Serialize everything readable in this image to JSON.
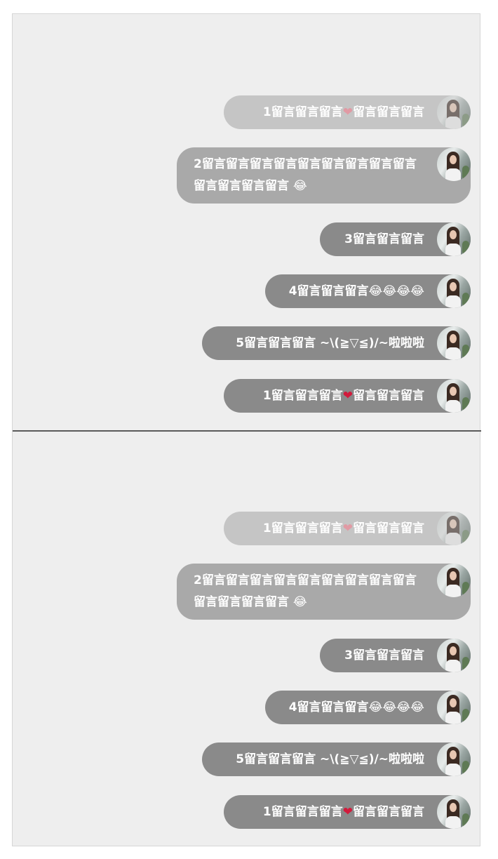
{
  "panels": [
    {
      "messages": [
        {
          "text": "1留言留言留言",
          "heart": "❤",
          "text_after": "留言留言留言"
        },
        {
          "text": "2留言留言留言留言留言留言留言留言留言留言留言留言留言 😂"
        },
        {
          "text": "3留言留言留言"
        },
        {
          "text": "4留言留言留言😂😂😂😂"
        },
        {
          "text": "5留言留言留言 ~\\(≧▽≦)/~啦啦啦"
        },
        {
          "text": "1留言留言留言",
          "heart": "❤",
          "text_after": "留言留言留言"
        }
      ]
    },
    {
      "messages": [
        {
          "text": "1留言留言留言",
          "heart": "❤",
          "text_after": "留言留言留言"
        },
        {
          "text": "2留言留言留言留言留言留言留言留言留言留言留言留言留言 😂"
        },
        {
          "text": "3留言留言留言"
        },
        {
          "text": "4留言留言留言😂😂😂😂"
        },
        {
          "text": "5留言留言留言 ~\\(≧▽≦)/~啦啦啦"
        },
        {
          "text": "1留言留言留言",
          "heart": "❤",
          "text_after": "留言留言留言"
        }
      ]
    }
  ],
  "icons": {
    "avatar": "user-avatar-photo",
    "heart": "heart-emoji",
    "laugh": "tears-of-joy-emoji"
  },
  "colors": {
    "background": "#eeeeee",
    "bubble_faded": "#c5c5c5",
    "bubble_mid": "#a9a9a9",
    "bubble_solid": "#8a8a8a",
    "heart": "#d21b3c",
    "divider": "#5a5a5a"
  }
}
